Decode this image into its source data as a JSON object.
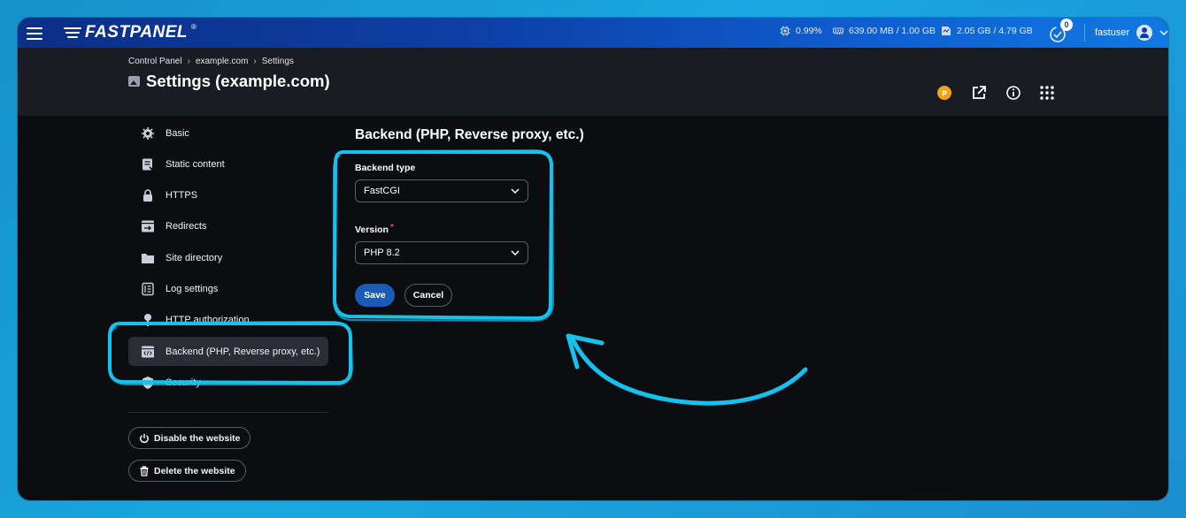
{
  "app": {
    "brand": "FASTPANEL",
    "brand_mark": "®"
  },
  "topbar": {
    "cpu": "0.99%",
    "memory": "639.00 MB / 1.00 GB",
    "disk": "2.05 GB / 4.79 GB",
    "notifications_count": "0",
    "username": "fastuser"
  },
  "breadcrumb": {
    "items": [
      "Control Panel",
      "example.com",
      "Settings"
    ],
    "separator": "›"
  },
  "page": {
    "title": "Settings (example.com)"
  },
  "sidebar": {
    "items": [
      {
        "label": "Basic",
        "icon": "gear-icon"
      },
      {
        "label": "Static content",
        "icon": "document-icon"
      },
      {
        "label": "HTTPS",
        "icon": "lock-icon"
      },
      {
        "label": "Redirects",
        "icon": "redirect-icon"
      },
      {
        "label": "Site directory",
        "icon": "folder-icon"
      },
      {
        "label": "Log settings",
        "icon": "log-icon"
      },
      {
        "label": "HTTP authorization",
        "icon": "key-icon"
      },
      {
        "label": "Backend (PHP, Reverse proxy, etc.)",
        "icon": "code-icon"
      },
      {
        "label": "Security",
        "icon": "shield-icon"
      }
    ],
    "active_index": 7,
    "disable_label": "Disable the website",
    "delete_label": "Delete the website"
  },
  "form": {
    "section_title": "Backend (PHP, Reverse proxy, etc.)",
    "backend_type_label": "Backend type",
    "backend_type_value": "FastCGI",
    "version_label": "Version",
    "version_required_mark": "*",
    "version_value": "PHP 8.2",
    "save_label": "Save",
    "cancel_label": "Cancel"
  },
  "colors": {
    "topbar": "#0d3fa6",
    "accent": "#1a5bb8",
    "highlight": "#15c2ee",
    "background": "#0c0d10",
    "header": "#191c23"
  }
}
